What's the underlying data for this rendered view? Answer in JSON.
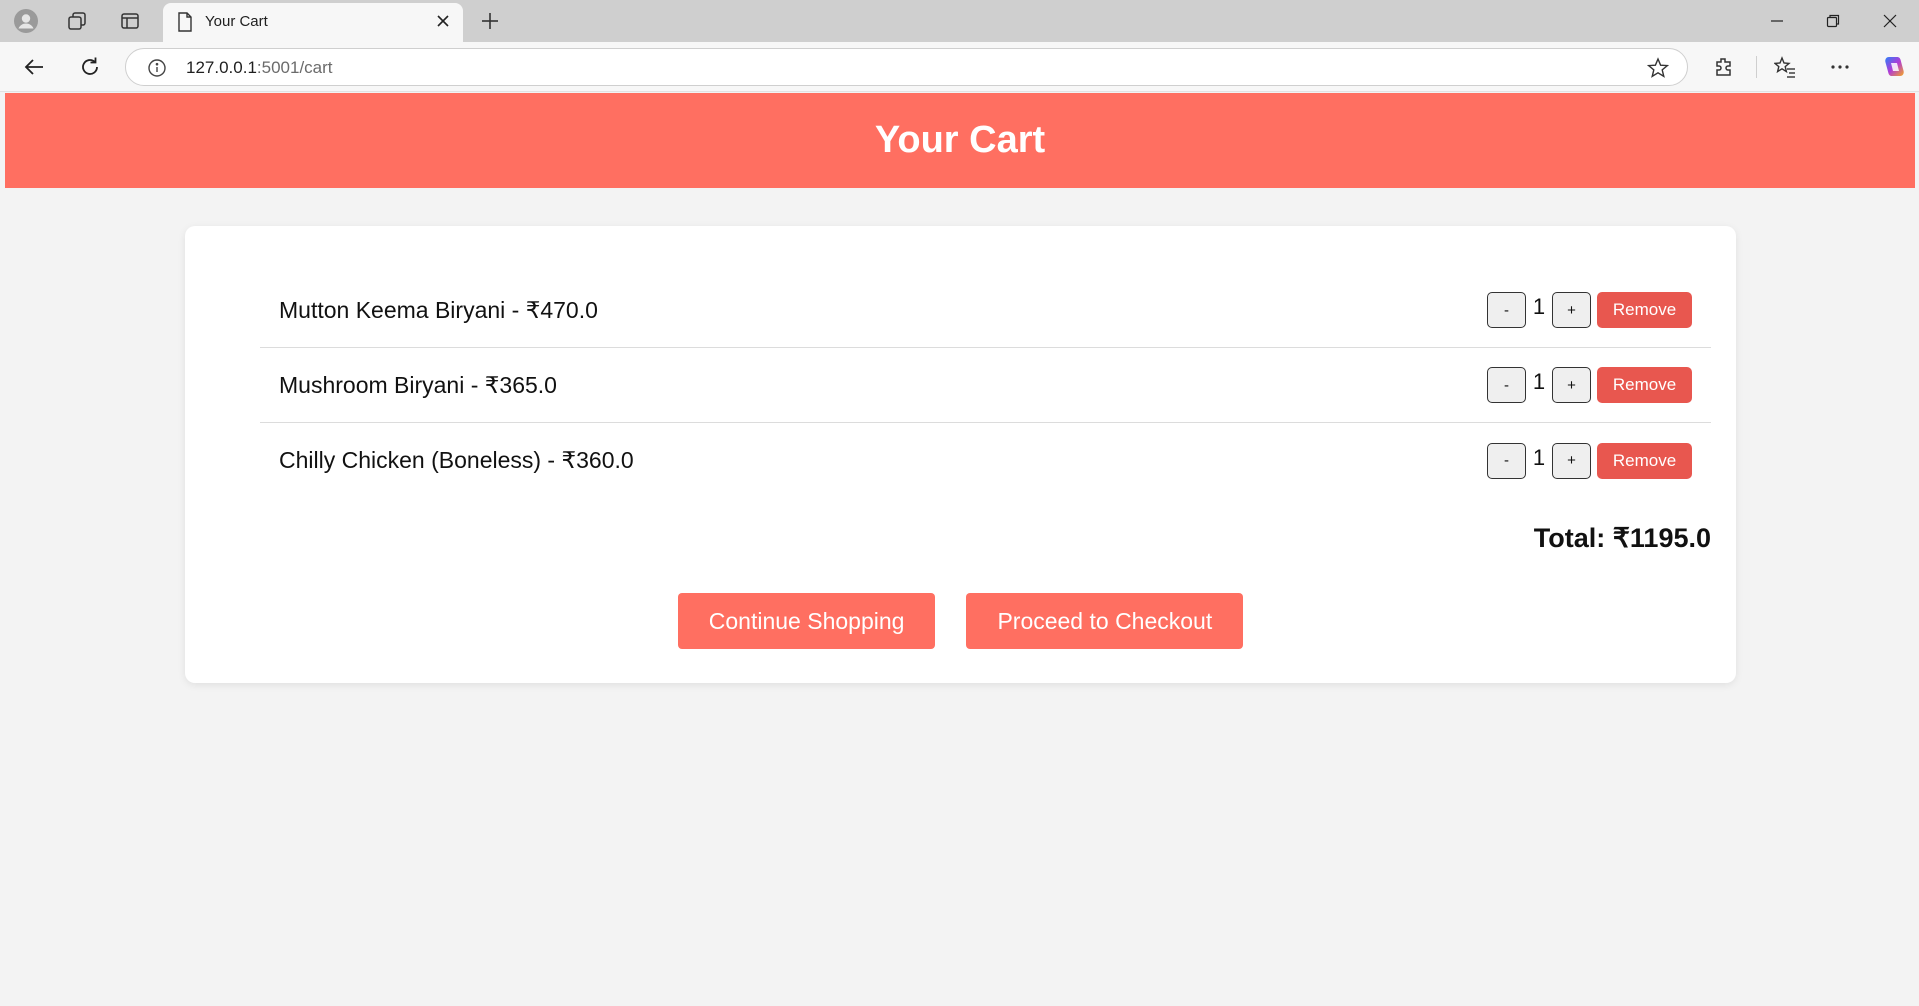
{
  "browser": {
    "tab_title": "Your Cart",
    "url_host": "127.0.0.1",
    "url_rest": ":5001/cart"
  },
  "page": {
    "header_title": "Your Cart",
    "currency_symbol": "₹",
    "items": [
      {
        "label": "Mutton Keema Biryani - ₹470.0",
        "quantity": "1",
        "minus": "-",
        "plus": "+",
        "remove": "Remove"
      },
      {
        "label": "Mushroom Biryani - ₹365.0",
        "quantity": "1",
        "minus": "-",
        "plus": "+",
        "remove": "Remove"
      },
      {
        "label": "Chilly Chicken (Boneless) - ₹360.0",
        "quantity": "1",
        "minus": "-",
        "plus": "+",
        "remove": "Remove"
      }
    ],
    "total": "Total: ₹1195.0",
    "continue_label": "Continue Shopping",
    "checkout_label": "Proceed to Checkout"
  },
  "colors": {
    "header_bg": "#ff6f61",
    "remove_bg": "#e8574f",
    "page_bg": "#f3f3f3"
  }
}
